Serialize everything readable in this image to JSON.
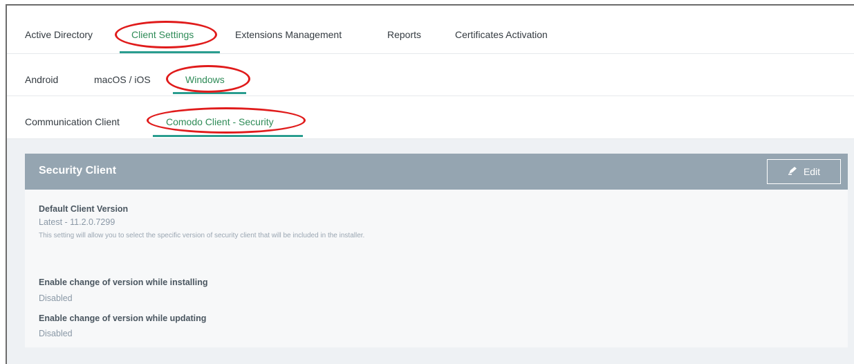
{
  "tabs_primary": {
    "active_directory": "Active Directory",
    "client_settings": "Client Settings",
    "extensions_management": "Extensions Management",
    "reports": "Reports",
    "certificates_activation": "Certificates Activation"
  },
  "tabs_os": {
    "android": "Android",
    "macos_ios": "macOS / iOS",
    "windows": "Windows"
  },
  "tabs_client": {
    "communication_client": "Communication Client",
    "comodo_client_security": "Comodo Client - Security"
  },
  "card": {
    "title": "Security Client",
    "edit_label": "Edit",
    "edit_icon": "pencil-edit-icon",
    "default_version_label": "Default Client Version",
    "default_version_value": "Latest - 11.2.0.7299",
    "default_version_desc": "This setting will allow you to select the specific version of security client that will be included in the installer.",
    "change_installing_label": "Enable change of version while installing",
    "change_installing_value": "Disabled",
    "change_updating_label": "Enable change of version while updating",
    "change_updating_value": "Disabled"
  },
  "colors": {
    "accent": "#2a9d8f",
    "annotation": "#e01b1b",
    "card_header": "#95a5b1"
  }
}
